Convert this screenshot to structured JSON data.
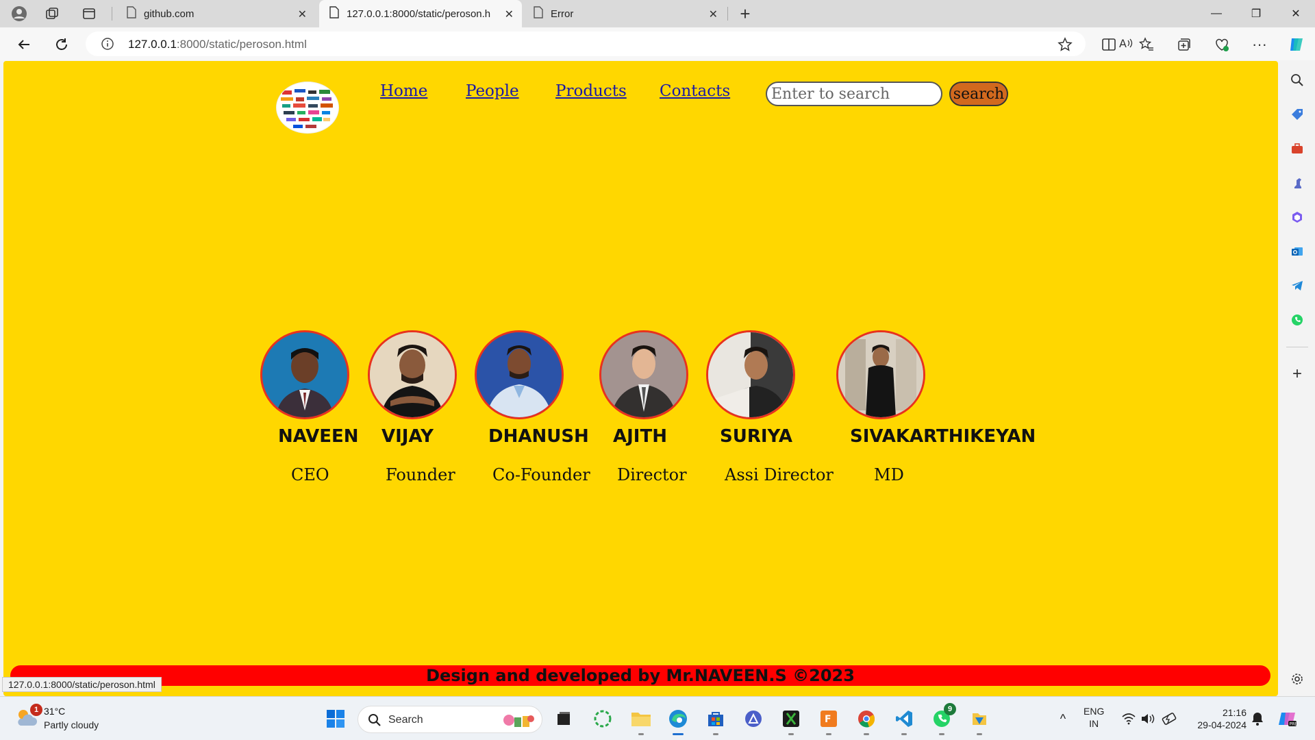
{
  "browser": {
    "tabs": [
      {
        "title": "github.com"
      },
      {
        "title": "127.0.0.1:8000/static/peroson.html"
      },
      {
        "title": "Error"
      }
    ],
    "url_host": "127.0.0.1",
    "url_path": ":8000/static/peroson.html",
    "status_url": "127.0.0.1:8000/static/peroson.html"
  },
  "site": {
    "nav": [
      "Home",
      "People",
      "Products",
      "Contacts"
    ],
    "search_placeholder": "Enter to search",
    "search_button": "search",
    "people": [
      {
        "name": "NAVEEN",
        "role": "CEO"
      },
      {
        "name": "VIJAY",
        "role": "Founder"
      },
      {
        "name": "DHANUSH",
        "role": "Co-Founder"
      },
      {
        "name": "AJITH",
        "role": "Director"
      },
      {
        "name": "SURIYA",
        "role": "Assi Director"
      },
      {
        "name": "SIVAKARTHIKEYAN",
        "role": "MD"
      }
    ],
    "footer": "Design and developed by Mr.NAVEEN.S ©2023"
  },
  "taskbar": {
    "weather_temp": "31°C",
    "weather_cond": "Partly cloudy",
    "weather_badge": "1",
    "search_label": "Search",
    "whatsapp_badge": "9",
    "lang": "ENG",
    "region": "IN",
    "time": "21:16",
    "date": "29-04-2024"
  },
  "colors": {
    "page_bg": "#ffd700",
    "footer_bg": "#ff0000",
    "avatar_border": "#e8321e",
    "search_btn": "#d2691e",
    "link": "#1a1aa6"
  }
}
